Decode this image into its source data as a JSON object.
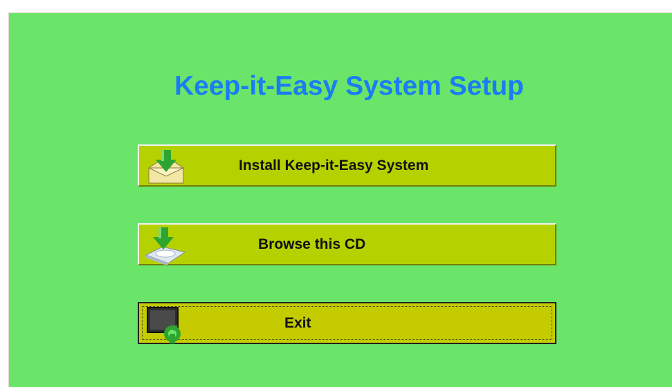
{
  "window": {
    "title": "Keep-it-Easy System Setup"
  },
  "buttons": {
    "install": {
      "label": "Install Keep-it-Easy System",
      "icon": "install-download-icon"
    },
    "browse": {
      "label": "Browse this CD",
      "icon": "browse-cd-icon"
    },
    "exit": {
      "label": "Exit",
      "icon": "exit-icon"
    }
  },
  "colors": {
    "background": "#6ae56a",
    "title": "#1a7df2",
    "button": "#b6d100",
    "button_exit": "#c4cc00"
  }
}
